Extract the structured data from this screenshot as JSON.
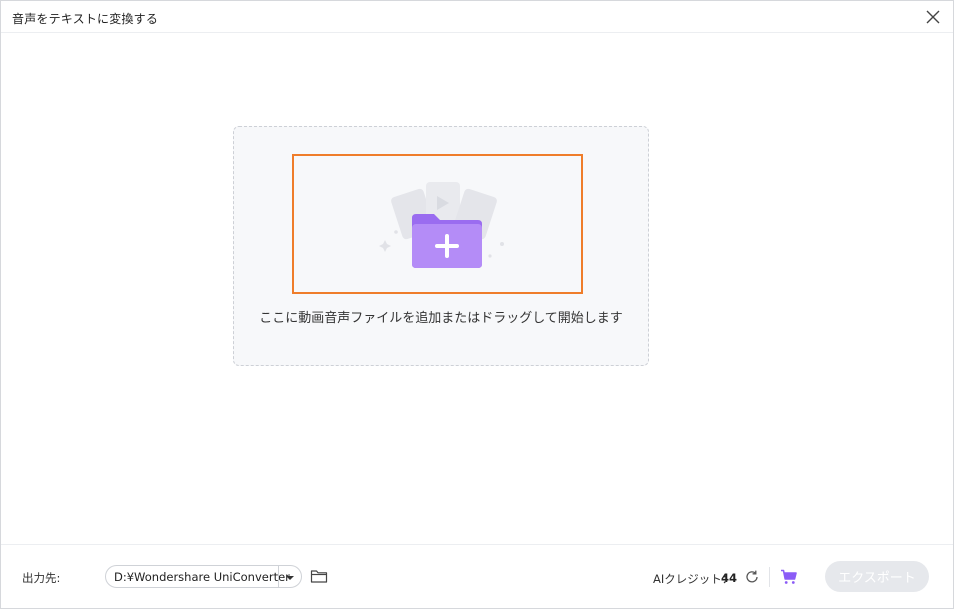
{
  "window": {
    "title": "音声をテキストに変換する"
  },
  "dropzone": {
    "hint": "ここに動画音声ファイルを追加またはドラッグして開始します",
    "icon": "add-folder-icon",
    "folder_color": "#a97bf5",
    "highlight_color": "#ef7d2a"
  },
  "footer": {
    "output_label": "出力先:",
    "output_path": "D:¥Wondershare UniConverter",
    "credit_label": "AIクレジット：",
    "credit_value": "44",
    "export_label": "エクスポート",
    "export_enabled": false,
    "accent_color": "#8b5cf6"
  }
}
